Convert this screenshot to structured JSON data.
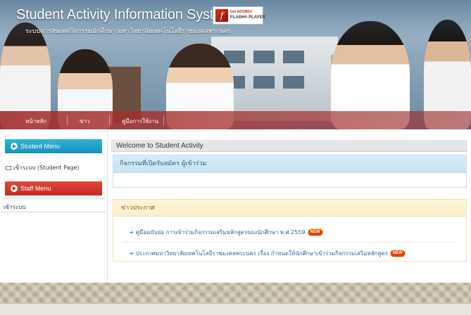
{
  "header": {
    "title": "Student Activity Information System",
    "subtitle": "ระบบสารสนเทศกิจกรรมนักศึกษา มหาวิทยาลัยเทคโนโลยีราชมงคลพระนคร",
    "flash_badge": {
      "line1": "Get ADOBE®",
      "line2": "FLASH® PLAYER",
      "icon": "flash-player-icon"
    },
    "nav": [
      {
        "label": "หน้าหลัก"
      },
      {
        "label": "ข่าว"
      },
      {
        "label": "คู่มือการใช้งาน"
      }
    ]
  },
  "sidebar": {
    "student_menu": {
      "title": "Student Menu",
      "items": [
        {
          "label": "เข้าระบบ (Student Page)"
        }
      ]
    },
    "staff_menu": {
      "title": "Staff Menu",
      "items": [
        {
          "label": "เข้าระบบ"
        }
      ]
    }
  },
  "main": {
    "welcome": "Welcome to Student Activity",
    "open_activities": {
      "heading": "กิจกรรมที่เปิดรับสมัคร ผู้เข้าร่วม"
    },
    "news": {
      "heading": "ข่าวประกาศ",
      "items": [
        {
          "text": "คู่มือฉบับย่อ การเข้าร่วมกิจกรรมเสริมหลักสูตรของนักศึกษา พ.ศ.2559",
          "badge": "NEW"
        },
        {
          "text": "ประกาศมหาวิทยาลัยเทคโนโลยีราชมงคลพระนคร เรื่อง กำหนดให้นักศึกษาเข้าร่วมกิจกรรมเสริมหลักสูตร",
          "badge": "NEW"
        }
      ]
    }
  },
  "footer": {
    "copyright": "Copyright © 2014. All Rights Reserved."
  },
  "colors": {
    "student_menu": "#1692ba",
    "staff_menu": "#c52a20",
    "nav_strip": "#a02828",
    "new_badge": "#e63a1a"
  }
}
